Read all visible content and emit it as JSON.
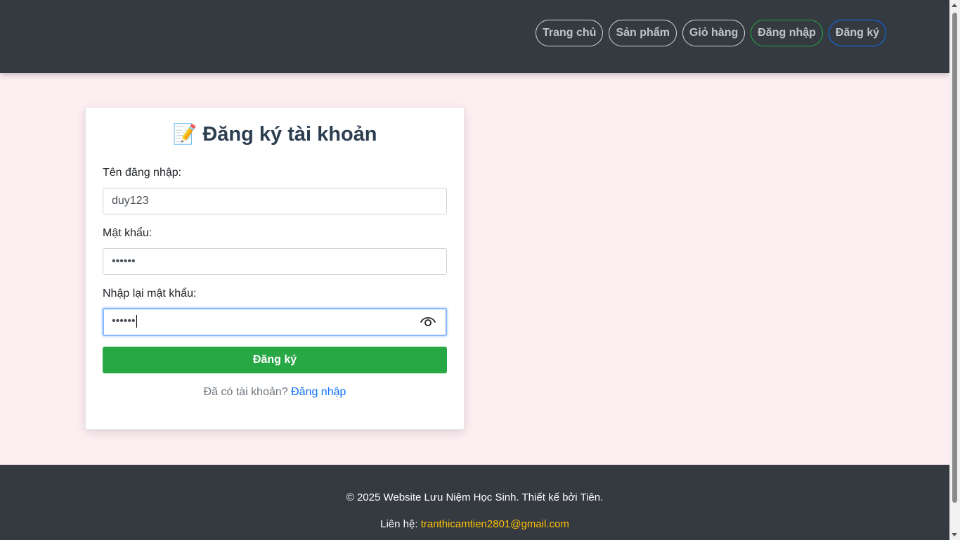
{
  "nav": {
    "items": [
      {
        "label": "Trang chủ"
      },
      {
        "label": "Sản phẩm"
      },
      {
        "label": "Giỏ hàng"
      },
      {
        "label": "Đăng nhập"
      },
      {
        "label": "Đăng ký"
      }
    ]
  },
  "form": {
    "title_icon": "📝",
    "title": "Đăng ký tài khoản",
    "username_label": "Tên đăng nhập:",
    "username_value": "duy123",
    "password_label": "Mật khẩu:",
    "password_value": "••••••",
    "confirm_label": "Nhập lại mật khẩu:",
    "confirm_value": "••••••",
    "confirm_icon": "eye-icon",
    "submit_label": "Đăng ký",
    "switch_text": "Đã có tài khoản?",
    "switch_link": "Đăng nhập"
  },
  "footer": {
    "copyright": "© 2025 Website Lưu Niệm Học Sinh. Thiết kế bởi Tiên.",
    "contact_label": "Liên hệ:",
    "contact_email": "tranthicamtien2801@gmail.com"
  },
  "colors": {
    "header_bg": "#343a40",
    "page_bg": "#fdeef2",
    "submit_bg": "#28a745",
    "link": "#0d6efd",
    "email": "#ffc107"
  }
}
